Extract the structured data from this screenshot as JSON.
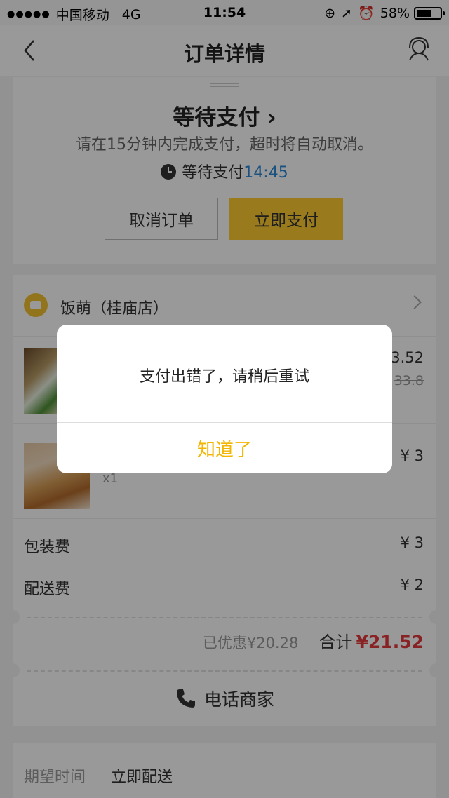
{
  "statusbar": {
    "signal_dots": "●●●●●",
    "carrier": "中国移动",
    "network": "4G",
    "time": "11:54",
    "battery": "58%"
  },
  "navbar": {
    "title": "订单详情"
  },
  "status": {
    "title": "等待支付 ›",
    "desc": "请在15分钟内完成支付，超时将自动取消。",
    "wait_label": "等待支付",
    "countdown": "14:45",
    "cancel_label": "取消订单",
    "pay_label": "立即支付"
  },
  "shop": {
    "name": "饭萌（桂庙店）"
  },
  "items": [
    {
      "price": "3.52",
      "old_price": "33.8"
    },
    {
      "price": "¥ 3",
      "qty": "x1"
    }
  ],
  "fees": {
    "pack_label": "包装费",
    "pack_value": "¥ 3",
    "delivery_label": "配送费",
    "delivery_value": "¥ 2"
  },
  "total": {
    "discount": "已优惠¥20.28",
    "label": "合计",
    "value": "¥21.52"
  },
  "contact": {
    "label": "电话商家"
  },
  "expect": {
    "label": "期望时间",
    "value": "立即配送"
  },
  "dialog": {
    "message": "支付出错了，请稍后重试",
    "confirm": "知道了"
  }
}
